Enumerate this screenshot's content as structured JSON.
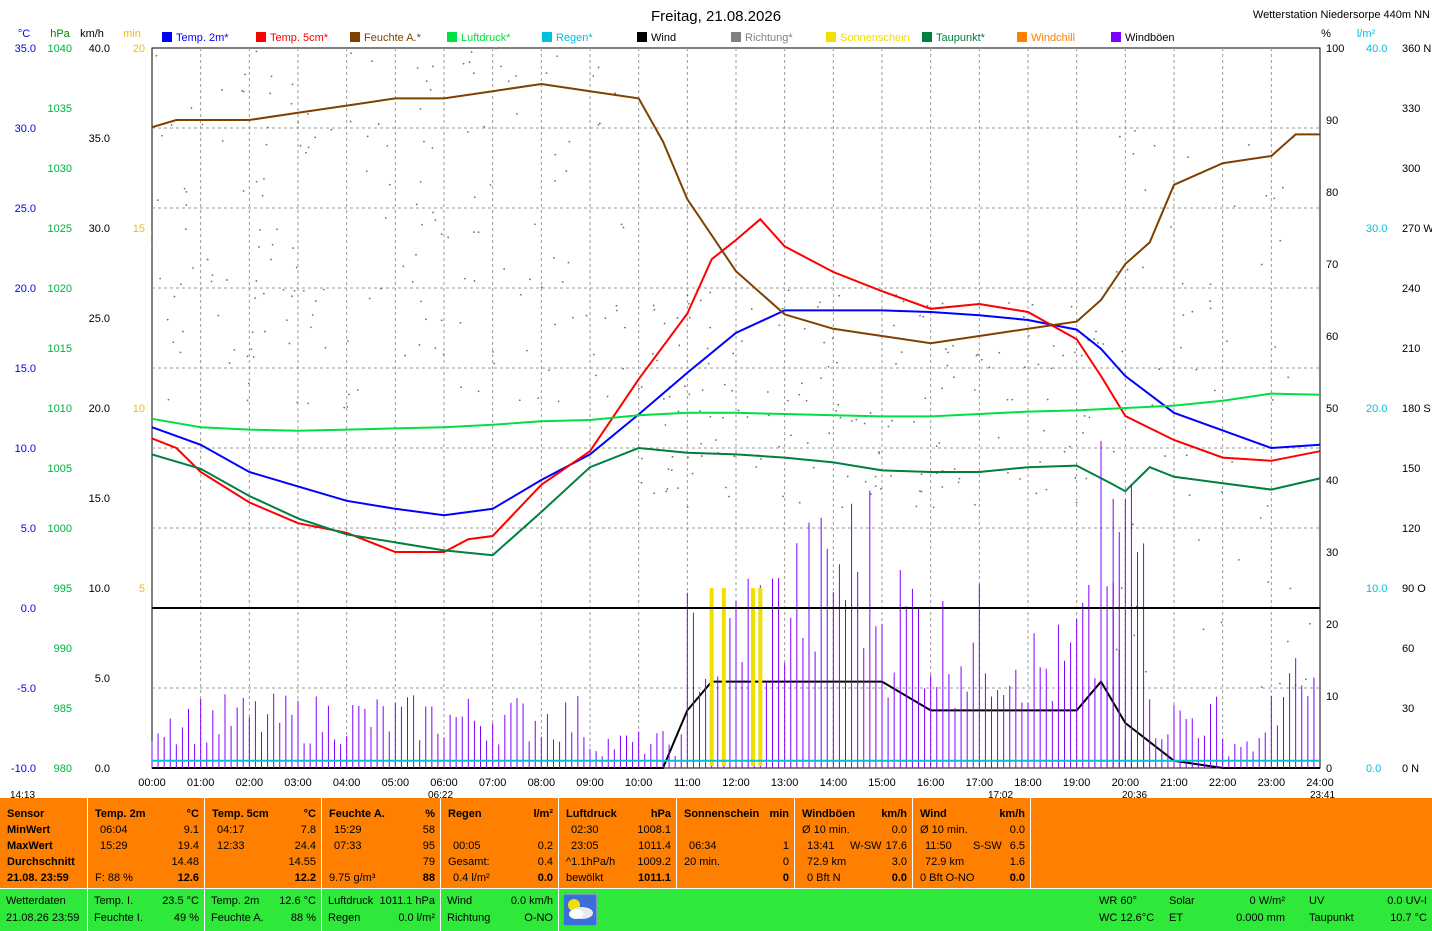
{
  "title": "Freitag, 21.08.2026",
  "station": "Wetterstation Niedersorpe 440m NN",
  "units_left": [
    "°C",
    "hPa",
    "km/h",
    "min"
  ],
  "units_right": [
    "%",
    "l/m²"
  ],
  "legend": [
    {
      "label": "Temp. 2m*",
      "color": "#0000ff"
    },
    {
      "label": "Temp. 5cm*",
      "color": "#ff0000"
    },
    {
      "label": "Feuchte A.*",
      "color": "#804000"
    },
    {
      "label": "Luftdruck*",
      "color": "#00e040"
    },
    {
      "label": "Regen*",
      "color": "#00c0e0"
    },
    {
      "label": "Wind",
      "color": "#000000"
    },
    {
      "label": "Richtung*",
      "color": "#808080"
    },
    {
      "label": "Sonnenschein",
      "color": "#f0e000"
    },
    {
      "label": "Taupunkt*",
      "color": "#008040"
    },
    {
      "label": "Windchill",
      "color": "#ff8000"
    },
    {
      "label": "Windböen",
      "color": "#8000ff"
    }
  ],
  "axes": {
    "temp": [
      "35.0",
      "30.0",
      "25.0",
      "20.0",
      "15.0",
      "10.0",
      "5.0",
      "0.0",
      "-5.0",
      "-10.0"
    ],
    "pressure": [
      "1040",
      "1035",
      "1030",
      "1025",
      "1020",
      "1015",
      "1010",
      "1005",
      "1000",
      "995",
      "990",
      "985",
      "980"
    ],
    "wind": [
      "40.0",
      "35.0",
      "30.0",
      "25.0",
      "20.0",
      "15.0",
      "10.0",
      "5.0",
      "0.0"
    ],
    "sun": [
      "20",
      "15",
      "10",
      "5"
    ],
    "humidity": [
      "100",
      "90",
      "80",
      "70",
      "60",
      "50",
      "40",
      "30",
      "20",
      "10",
      "0"
    ],
    "rain": [
      "40.0",
      "30.0",
      "20.0",
      "10.0",
      "0.0"
    ],
    "direction": [
      "360 N",
      "330",
      "300",
      "270 W",
      "240",
      "210",
      "180 S",
      "150",
      "120",
      "90 O",
      "60",
      "30",
      "0 N"
    ],
    "time": [
      "00:00",
      "01:00",
      "02:00",
      "03:00",
      "04:00",
      "05:00",
      "06:00",
      "07:00",
      "08:00",
      "09:00",
      "10:00",
      "11:00",
      "12:00",
      "13:00",
      "14:00",
      "15:00",
      "16:00",
      "17:00",
      "18:00",
      "19:00",
      "20:00",
      "21:00",
      "22:00",
      "23:00",
      "24:00"
    ]
  },
  "astro": {
    "moonrise": "14:13",
    "sunrise": "06:22",
    "moon2": "17:02",
    "sunset": "20:36",
    "moonset": "23:41"
  },
  "chart_data": {
    "type": "line",
    "title": "Freitag, 21.08.2026",
    "x_unit": "hours",
    "series": [
      {
        "name": "Temp. 2m*",
        "unit": "°C",
        "x": [
          0,
          1,
          2,
          3,
          4,
          5,
          6,
          7,
          8,
          9,
          10,
          11,
          12,
          13,
          14,
          15,
          16,
          17,
          18,
          19,
          19.5,
          20,
          21,
          22,
          23,
          24
        ],
        "y": [
          11.3,
          10.2,
          8.5,
          7.6,
          6.7,
          6.2,
          5.8,
          6.2,
          8.0,
          9.6,
          12.1,
          14.7,
          17.2,
          18.6,
          18.6,
          18.6,
          18.5,
          18.3,
          18.0,
          17.4,
          16.2,
          14.5,
          12.2,
          11.1,
          10.0,
          10.2
        ]
      },
      {
        "name": "Temp. 5cm*",
        "unit": "°C",
        "x": [
          0,
          0.5,
          1,
          2,
          3,
          4,
          5,
          6,
          6.5,
          7,
          8,
          9,
          10,
          11,
          11.5,
          12,
          12.5,
          13,
          14,
          15,
          16,
          17,
          18,
          19,
          19.5,
          20,
          21,
          22,
          23,
          24
        ],
        "y": [
          10.6,
          10.0,
          8.5,
          6.6,
          5.3,
          4.7,
          3.5,
          3.5,
          4.3,
          4.5,
          7.7,
          9.8,
          14.3,
          18.4,
          21.8,
          23.0,
          24.3,
          22.6,
          21.0,
          19.8,
          18.7,
          19.0,
          18.5,
          16.8,
          14.5,
          12.0,
          10.5,
          9.4,
          9.2,
          9.8
        ]
      },
      {
        "name": "Feuchte A.*",
        "unit": "%",
        "x": [
          0,
          0.5,
          1,
          2,
          3,
          4,
          5,
          6,
          7,
          8,
          9,
          10,
          10.5,
          11,
          12,
          13,
          14,
          15,
          16,
          17,
          18,
          19,
          19.5,
          20,
          20.5,
          21,
          22,
          23,
          23.5,
          24
        ],
        "y": [
          89,
          90,
          90,
          90,
          91,
          92,
          93,
          93,
          94,
          95,
          94,
          93,
          87,
          79,
          69,
          63,
          61,
          60,
          59,
          60,
          61,
          62,
          65,
          70,
          73,
          81,
          84,
          85,
          88,
          88
        ]
      },
      {
        "name": "Luftdruck*",
        "unit": "hPa",
        "x": [
          0,
          1,
          2,
          3,
          4,
          5,
          6,
          7,
          8,
          9,
          10,
          11,
          12,
          13,
          14,
          15,
          16,
          17,
          18,
          19,
          20,
          21,
          22,
          23,
          24
        ],
        "y": [
          1009.1,
          1008.4,
          1008.2,
          1008.1,
          1008.2,
          1008.3,
          1008.4,
          1008.6,
          1008.9,
          1009.0,
          1009.4,
          1009.6,
          1009.6,
          1009.5,
          1009.4,
          1009.3,
          1009.3,
          1009.5,
          1009.7,
          1009.8,
          1010.0,
          1010.2,
          1010.6,
          1011.2,
          1011.1
        ]
      },
      {
        "name": "Taupunkt*",
        "unit": "°C",
        "x": [
          0,
          1,
          2,
          3,
          4,
          5,
          6,
          7,
          8,
          9,
          10,
          11,
          12,
          13,
          14,
          15,
          16,
          17,
          18,
          19,
          19.7,
          20,
          20.5,
          21,
          22,
          23,
          24
        ],
        "y": [
          9.6,
          8.7,
          7.0,
          5.6,
          4.6,
          4.1,
          3.6,
          3.3,
          6.0,
          8.8,
          10.0,
          9.7,
          9.6,
          9.4,
          9.1,
          8.6,
          8.5,
          8.5,
          8.8,
          8.9,
          7.8,
          7.3,
          8.8,
          8.2,
          7.8,
          7.4,
          8.1
        ]
      },
      {
        "name": "Wind",
        "unit": "km/h",
        "x": [
          0,
          10.5,
          11,
          11.5,
          12,
          13,
          14,
          15,
          16,
          17,
          18,
          19,
          19.5,
          20,
          21,
          22,
          23,
          24
        ],
        "y": [
          0,
          0,
          3.2,
          4.8,
          4.8,
          4.8,
          4.8,
          4.8,
          3.2,
          3.2,
          3.2,
          3.2,
          4.8,
          2.5,
          0.4,
          0,
          0,
          0
        ]
      },
      {
        "name": "Windböen",
        "unit": "km/h",
        "x": [
          0,
          1,
          2,
          3,
          4,
          5,
          6,
          7,
          8,
          9,
          10,
          11,
          12,
          13,
          14,
          15,
          16,
          17,
          18,
          19,
          19.5,
          20,
          21,
          22,
          23,
          24
        ],
        "y": [
          3.2,
          3.2,
          3.2,
          3.2,
          3.2,
          3.2,
          3.2,
          3.2,
          3.2,
          1.6,
          1.6,
          8.0,
          9.6,
          11.2,
          12.8,
          9.6,
          8.0,
          8.0,
          6.4,
          8.0,
          14.5,
          3.2,
          3.2,
          1.6,
          4.8,
          1.6
        ]
      },
      {
        "name": "Sonnenschein",
        "unit": "min",
        "x": [
          11.5,
          11.75,
          12.35,
          12.5
        ],
        "y": [
          1,
          1,
          1,
          1
        ]
      },
      {
        "name": "Regen*",
        "unit": "l/m²",
        "x": [
          0,
          24
        ],
        "y": [
          0.4,
          0.4
        ]
      }
    ],
    "limits": {
      "temp": [
        -10,
        35
      ],
      "pressure": [
        980,
        1040
      ],
      "wind": [
        0,
        40
      ],
      "humidity": [
        0,
        100
      ],
      "rain": [
        0,
        40
      ],
      "direction": [
        0,
        360
      ],
      "sun": [
        0,
        20
      ]
    }
  },
  "stats": {
    "sensor": {
      "title": "Sensor",
      "rows": [
        "MinWert",
        "MaxWert",
        "Durchschnitt"
      ],
      "date": "21.08. 23:59"
    },
    "temp2m": {
      "title": "Temp. 2m",
      "unit": "°C",
      "min_t": "06:04",
      "min_v": "9.1",
      "max_t": "15:29",
      "max_v": "19.4",
      "avg": "14.48",
      "extra_l": "F: 88 %",
      "extra_v": "12.6"
    },
    "temp5cm": {
      "title": "Temp. 5cm",
      "unit": "°C",
      "min_t": "04:17",
      "min_v": "7.8",
      "max_t": "12:33",
      "max_v": "24.4",
      "avg": "14.55",
      "extra_v": "12.2"
    },
    "feuchte": {
      "title": "Feuchte A.",
      "unit": "%",
      "min_t": "15:29",
      "min_v": "58",
      "max_t": "07:33",
      "max_v": "95",
      "avg": "79",
      "extra_l": "9.75 g/m³",
      "extra_v": "88"
    },
    "regen": {
      "title": "Regen",
      "unit": "l/m²",
      "r1_t": "00:05",
      "r1_v": "0.2",
      "r2_t": "Gesamt:",
      "r2_v": "0.4",
      "r3_t": "0.4 l/m²",
      "r3_v": "0.0"
    },
    "luftdruck": {
      "title": "Luftdruck",
      "unit": "hPa",
      "min_t": "02:30",
      "min_v": "1008.1",
      "max_t": "23:05",
      "max_v": "1011.4",
      "avg_t": "^1.1hPa/h",
      "avg_v": "1009.2",
      "ex_t": "bewölkt",
      "ex_v": "1011.1"
    },
    "sonne": {
      "title": "Sonnenschein",
      "unit": "min",
      "r1_t": "06:34",
      "r1_v": "1",
      "r2_t": "20 min.",
      "r2_v": "0",
      "r3_v": "0"
    },
    "boeen": {
      "title": "Windböen",
      "unit": "km/h",
      "r0_t": "Ø 10 min.",
      "r0_v": "0.0",
      "r1_t": "13:41",
      "r1_d": "W-SW",
      "r1_v": "17.6",
      "r2_t": "72.9 km",
      "r2_v": "3.0",
      "r3_t": "0 Bft N",
      "r3_v": "0.0"
    },
    "wind": {
      "title": "Wind",
      "unit": "km/h",
      "r0_t": "Ø 10 min.",
      "r0_v": "0.0",
      "r1_t": "11:50",
      "r1_d": "S-SW",
      "r1_v": "6.5",
      "r2_t": "72.9 km",
      "r2_v": "1.6",
      "r3_t": "0 Bft O-NO",
      "r3_v": "0.0"
    }
  },
  "current": {
    "label": "Wetterdaten",
    "date": "21.08.26 23:59",
    "temp_i_l": "Temp. I.",
    "temp_i_v": "23.5 °C",
    "feuchte_i_l": "Feuchte I.",
    "feuchte_i_v": "49 %",
    "temp2_l": "Temp. 2m",
    "temp2_v": "12.6 °C",
    "feuchte_a_l": "Feuchte A.",
    "feuchte_a_v": "88 %",
    "druck_l": "Luftdruck",
    "druck_v": "1011.1 hPa",
    "regen_l": "Regen",
    "regen_v": "0.0 l/m²",
    "wind_l": "Wind",
    "wind_v": "0.0 km/h",
    "richtung_l": "Richtung",
    "richtung_v": "O-NO",
    "wr": "WR 60°",
    "wc": "WC 12.6°C",
    "solar_l": "Solar",
    "solar_v": "0 W/m²",
    "et_l": "ET",
    "et_v": "0.000 mm",
    "uv_l": "UV",
    "uv_v": "0.0 UV-I",
    "tau_l": "Taupunkt",
    "tau_v": "10.7 °C"
  }
}
